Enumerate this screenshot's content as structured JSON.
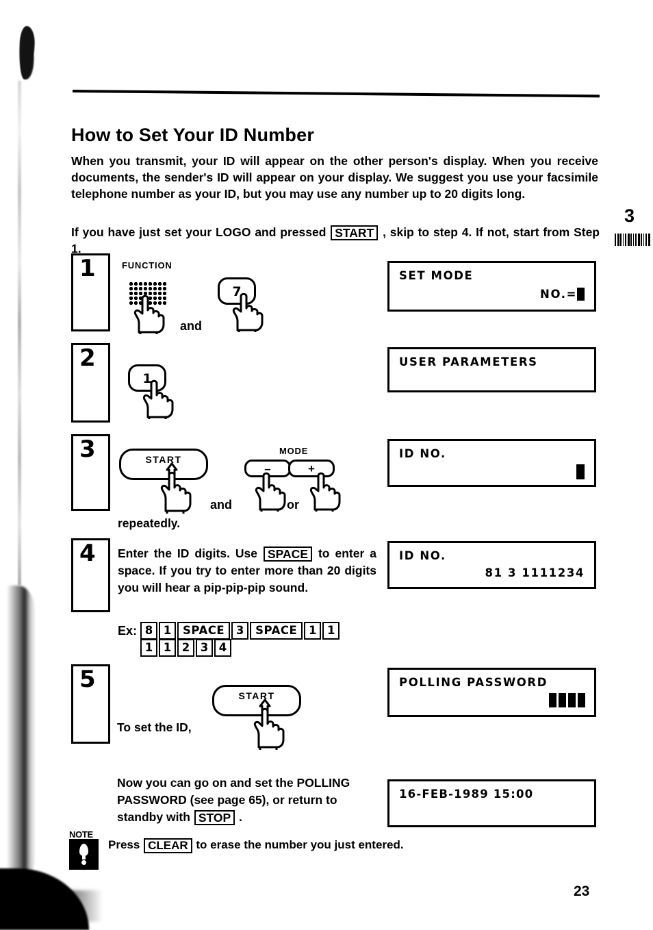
{
  "page": {
    "heading": "How to Set Your ID Number",
    "chapter_marker": "3",
    "page_number": "23",
    "intro_paragraph": "When you transmit, your ID will appear on the other person's display. When you receive documents, the sender's ID will appear on your display. We suggest you use your facsimile telephone number as your ID, but you may use any number up to 20 digits long.",
    "intro_before_key": "If you have just set your LOGO and pressed",
    "intro_key": "START",
    "intro_after_key": ", skip to step 4. If not, start from Step 1."
  },
  "steps": [
    {
      "number": "1",
      "function_label": "FUNCTION",
      "key_label": "7",
      "conjunction": "and",
      "display": {
        "line1": "SET  MODE",
        "line2": "NO.=",
        "cursor": true
      }
    },
    {
      "number": "2",
      "key_label": "1",
      "display": {
        "line1": "USER  PARAMETERS",
        "line2": ""
      }
    },
    {
      "number": "3",
      "start_label": "START",
      "mode_label": "MODE",
      "mode_minus": "–",
      "mode_plus": "+",
      "conjunction": "and",
      "conjunction2": "or",
      "note": "repeatedly.",
      "display": {
        "line1": "ID NO.",
        "line2": "",
        "cursor_block": true
      }
    },
    {
      "number": "4",
      "text_before_key": "Enter the ID digits. Use",
      "text_key": "SPACE",
      "text_after_key": "to enter a space. If you try to enter more than 20 digits you will hear a pip-pip-pip sound.",
      "example_label": "Ex:",
      "example_keys_row1": [
        "8",
        "1",
        "SPACE",
        "3",
        "SPACE",
        "1",
        "1"
      ],
      "example_keys_row2": [
        "1",
        "1",
        "2",
        "3",
        "4"
      ],
      "display": {
        "line1": "ID NO.",
        "line2": "81  3  1111234"
      }
    },
    {
      "number": "5",
      "start_label": "START",
      "caption": "To set the ID,",
      "display": {
        "line1": "POLLING  PASSWORD",
        "line2": "",
        "password_blocks": 4
      }
    }
  ],
  "closing": {
    "text_before_key": "Now you can go on and set the POLLING PASSWORD (see page 65), or return to standby with",
    "text_key": "STOP",
    "text_after_key": ".",
    "display": {
      "line1": "16-FEB-1989  15:00"
    }
  },
  "note": {
    "badge_label": "NOTE",
    "badge_icon": "exclamation-icon",
    "text_before_key": "Press",
    "text_key": "CLEAR",
    "text_after_key": "to erase the number you just entered."
  }
}
